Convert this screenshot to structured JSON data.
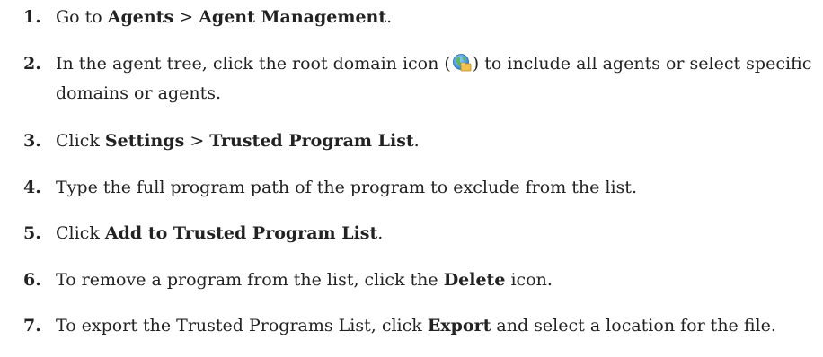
{
  "steps": [
    {
      "number": "1.",
      "t1": "Go to ",
      "b1": "Agents",
      "t2": " > ",
      "b2": "Agent Management",
      "t3": "."
    },
    {
      "number": "2.",
      "t1": "In the agent tree, click the root domain icon (",
      "icon": "root-domain-globe-icon",
      "t2": ") to include all agents or select specific domains or agents."
    },
    {
      "number": "3.",
      "t1": "Click ",
      "b1": "Settings",
      "t2": " > ",
      "b2": "Trusted Program List",
      "t3": "."
    },
    {
      "number": "4.",
      "t1": "Type the full program path of the program to exclude from the list."
    },
    {
      "number": "5.",
      "t1": "Click ",
      "b1": "Add to Trusted Program List",
      "t2": "."
    },
    {
      "number": "6.",
      "t1": "To remove a program from the list, click the ",
      "b1": "Delete",
      "t2": " icon."
    },
    {
      "number": "7.",
      "t1": "To export the Trusted Programs List, click ",
      "b1": "Export",
      "t2": " and select a location for the file."
    }
  ],
  "colors": {
    "text": "#222222",
    "icon_globe": "#3a8fd6",
    "icon_land": "#5cb85c",
    "icon_folder": "#f0c24b"
  }
}
